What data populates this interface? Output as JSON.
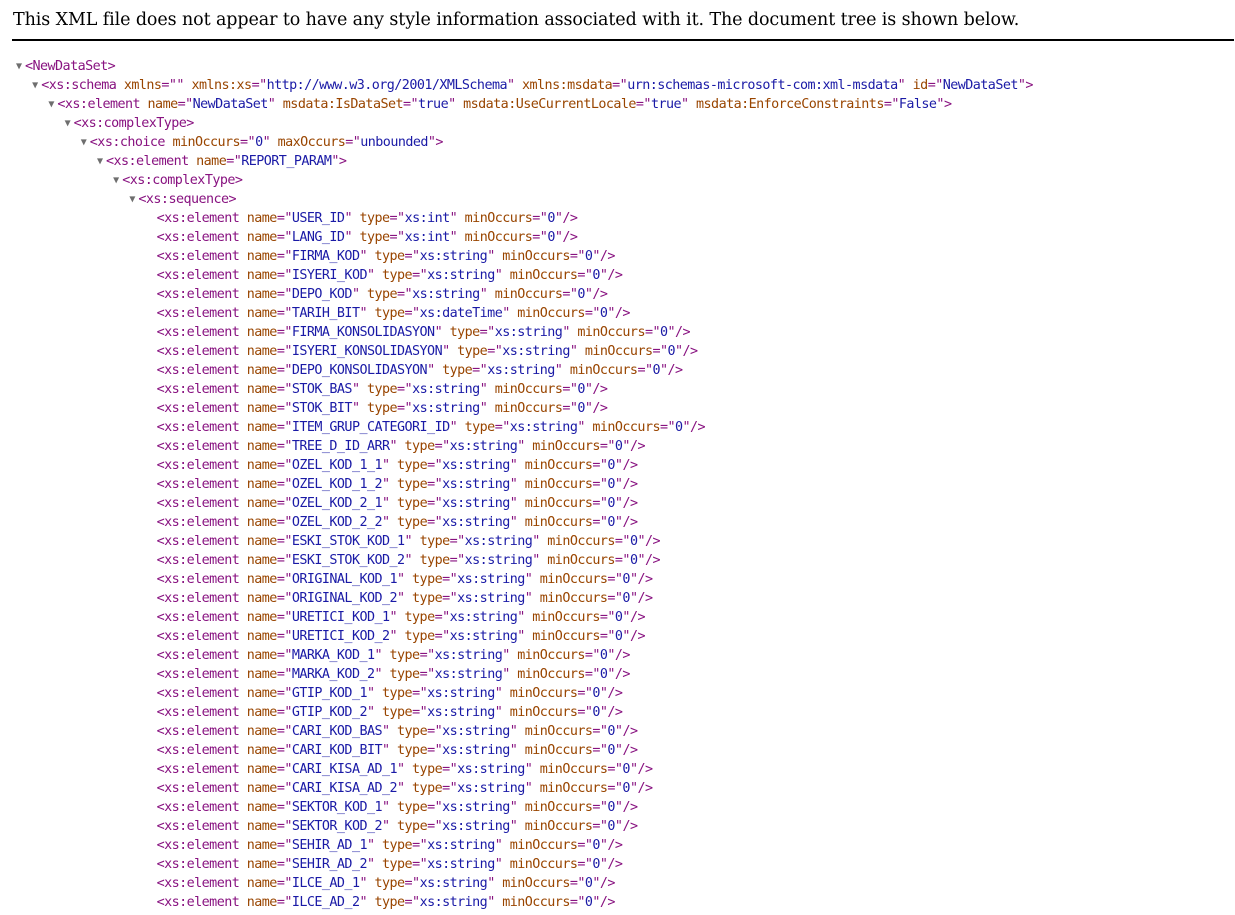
{
  "info_message": "This XML file does not appear to have any style information associated with it. The document tree is shown below.",
  "toggle_glyph": "▼",
  "tree": [
    {
      "depth": 0,
      "toggle": true,
      "tag": "NewDataSet",
      "attrs": [],
      "selfclose": false
    },
    {
      "depth": 1,
      "toggle": true,
      "tag": "xs:schema",
      "attrs": [
        {
          "n": "xmlns",
          "v": ""
        },
        {
          "n": "xmlns:xs",
          "v": "http://www.w3.org/2001/XMLSchema"
        },
        {
          "n": "xmlns:msdata",
          "v": "urn:schemas-microsoft-com:xml-msdata"
        },
        {
          "n": "id",
          "v": "NewDataSet"
        }
      ],
      "selfclose": false
    },
    {
      "depth": 2,
      "toggle": true,
      "tag": "xs:element",
      "attrs": [
        {
          "n": "name",
          "v": "NewDataSet"
        },
        {
          "n": "msdata:IsDataSet",
          "v": "true"
        },
        {
          "n": "msdata:UseCurrentLocale",
          "v": "true"
        },
        {
          "n": "msdata:EnforceConstraints",
          "v": "False"
        }
      ],
      "selfclose": false
    },
    {
      "depth": 3,
      "toggle": true,
      "tag": "xs:complexType",
      "attrs": [],
      "selfclose": false
    },
    {
      "depth": 4,
      "toggle": true,
      "tag": "xs:choice",
      "attrs": [
        {
          "n": "minOccurs",
          "v": "0"
        },
        {
          "n": "maxOccurs",
          "v": "unbounded"
        }
      ],
      "selfclose": false
    },
    {
      "depth": 5,
      "toggle": true,
      "tag": "xs:element",
      "attrs": [
        {
          "n": "name",
          "v": "REPORT_PARAM"
        }
      ],
      "selfclose": false
    },
    {
      "depth": 6,
      "toggle": true,
      "tag": "xs:complexType",
      "attrs": [],
      "selfclose": false
    },
    {
      "depth": 7,
      "toggle": true,
      "tag": "xs:sequence",
      "attrs": [],
      "selfclose": false
    },
    {
      "depth": 8,
      "toggle": false,
      "tag": "xs:element",
      "attrs": [
        {
          "n": "name",
          "v": "USER_ID"
        },
        {
          "n": "type",
          "v": "xs:int"
        },
        {
          "n": "minOccurs",
          "v": "0"
        }
      ],
      "selfclose": true
    },
    {
      "depth": 8,
      "toggle": false,
      "tag": "xs:element",
      "attrs": [
        {
          "n": "name",
          "v": "LANG_ID"
        },
        {
          "n": "type",
          "v": "xs:int"
        },
        {
          "n": "minOccurs",
          "v": "0"
        }
      ],
      "selfclose": true
    },
    {
      "depth": 8,
      "toggle": false,
      "tag": "xs:element",
      "attrs": [
        {
          "n": "name",
          "v": "FIRMA_KOD"
        },
        {
          "n": "type",
          "v": "xs:string"
        },
        {
          "n": "minOccurs",
          "v": "0"
        }
      ],
      "selfclose": true
    },
    {
      "depth": 8,
      "toggle": false,
      "tag": "xs:element",
      "attrs": [
        {
          "n": "name",
          "v": "ISYERI_KOD"
        },
        {
          "n": "type",
          "v": "xs:string"
        },
        {
          "n": "minOccurs",
          "v": "0"
        }
      ],
      "selfclose": true
    },
    {
      "depth": 8,
      "toggle": false,
      "tag": "xs:element",
      "attrs": [
        {
          "n": "name",
          "v": "DEPO_KOD"
        },
        {
          "n": "type",
          "v": "xs:string"
        },
        {
          "n": "minOccurs",
          "v": "0"
        }
      ],
      "selfclose": true
    },
    {
      "depth": 8,
      "toggle": false,
      "tag": "xs:element",
      "attrs": [
        {
          "n": "name",
          "v": "TARIH_BIT"
        },
        {
          "n": "type",
          "v": "xs:dateTime"
        },
        {
          "n": "minOccurs",
          "v": "0"
        }
      ],
      "selfclose": true
    },
    {
      "depth": 8,
      "toggle": false,
      "tag": "xs:element",
      "attrs": [
        {
          "n": "name",
          "v": "FIRMA_KONSOLIDASYON"
        },
        {
          "n": "type",
          "v": "xs:string"
        },
        {
          "n": "minOccurs",
          "v": "0"
        }
      ],
      "selfclose": true
    },
    {
      "depth": 8,
      "toggle": false,
      "tag": "xs:element",
      "attrs": [
        {
          "n": "name",
          "v": "ISYERI_KONSOLIDASYON"
        },
        {
          "n": "type",
          "v": "xs:string"
        },
        {
          "n": "minOccurs",
          "v": "0"
        }
      ],
      "selfclose": true
    },
    {
      "depth": 8,
      "toggle": false,
      "tag": "xs:element",
      "attrs": [
        {
          "n": "name",
          "v": "DEPO_KONSOLIDASYON"
        },
        {
          "n": "type",
          "v": "xs:string"
        },
        {
          "n": "minOccurs",
          "v": "0"
        }
      ],
      "selfclose": true
    },
    {
      "depth": 8,
      "toggle": false,
      "tag": "xs:element",
      "attrs": [
        {
          "n": "name",
          "v": "STOK_BAS"
        },
        {
          "n": "type",
          "v": "xs:string"
        },
        {
          "n": "minOccurs",
          "v": "0"
        }
      ],
      "selfclose": true
    },
    {
      "depth": 8,
      "toggle": false,
      "tag": "xs:element",
      "attrs": [
        {
          "n": "name",
          "v": "STOK_BIT"
        },
        {
          "n": "type",
          "v": "xs:string"
        },
        {
          "n": "minOccurs",
          "v": "0"
        }
      ],
      "selfclose": true
    },
    {
      "depth": 8,
      "toggle": false,
      "tag": "xs:element",
      "attrs": [
        {
          "n": "name",
          "v": "ITEM_GRUP_CATEGORI_ID"
        },
        {
          "n": "type",
          "v": "xs:string"
        },
        {
          "n": "minOccurs",
          "v": "0"
        }
      ],
      "selfclose": true
    },
    {
      "depth": 8,
      "toggle": false,
      "tag": "xs:element",
      "attrs": [
        {
          "n": "name",
          "v": "TREE_D_ID_ARR"
        },
        {
          "n": "type",
          "v": "xs:string"
        },
        {
          "n": "minOccurs",
          "v": "0"
        }
      ],
      "selfclose": true
    },
    {
      "depth": 8,
      "toggle": false,
      "tag": "xs:element",
      "attrs": [
        {
          "n": "name",
          "v": "OZEL_KOD_1_1"
        },
        {
          "n": "type",
          "v": "xs:string"
        },
        {
          "n": "minOccurs",
          "v": "0"
        }
      ],
      "selfclose": true
    },
    {
      "depth": 8,
      "toggle": false,
      "tag": "xs:element",
      "attrs": [
        {
          "n": "name",
          "v": "OZEL_KOD_1_2"
        },
        {
          "n": "type",
          "v": "xs:string"
        },
        {
          "n": "minOccurs",
          "v": "0"
        }
      ],
      "selfclose": true
    },
    {
      "depth": 8,
      "toggle": false,
      "tag": "xs:element",
      "attrs": [
        {
          "n": "name",
          "v": "OZEL_KOD_2_1"
        },
        {
          "n": "type",
          "v": "xs:string"
        },
        {
          "n": "minOccurs",
          "v": "0"
        }
      ],
      "selfclose": true
    },
    {
      "depth": 8,
      "toggle": false,
      "tag": "xs:element",
      "attrs": [
        {
          "n": "name",
          "v": "OZEL_KOD_2_2"
        },
        {
          "n": "type",
          "v": "xs:string"
        },
        {
          "n": "minOccurs",
          "v": "0"
        }
      ],
      "selfclose": true
    },
    {
      "depth": 8,
      "toggle": false,
      "tag": "xs:element",
      "attrs": [
        {
          "n": "name",
          "v": "ESKI_STOK_KOD_1"
        },
        {
          "n": "type",
          "v": "xs:string"
        },
        {
          "n": "minOccurs",
          "v": "0"
        }
      ],
      "selfclose": true
    },
    {
      "depth": 8,
      "toggle": false,
      "tag": "xs:element",
      "attrs": [
        {
          "n": "name",
          "v": "ESKI_STOK_KOD_2"
        },
        {
          "n": "type",
          "v": "xs:string"
        },
        {
          "n": "minOccurs",
          "v": "0"
        }
      ],
      "selfclose": true
    },
    {
      "depth": 8,
      "toggle": false,
      "tag": "xs:element",
      "attrs": [
        {
          "n": "name",
          "v": "ORIGINAL_KOD_1"
        },
        {
          "n": "type",
          "v": "xs:string"
        },
        {
          "n": "minOccurs",
          "v": "0"
        }
      ],
      "selfclose": true
    },
    {
      "depth": 8,
      "toggle": false,
      "tag": "xs:element",
      "attrs": [
        {
          "n": "name",
          "v": "ORIGINAL_KOD_2"
        },
        {
          "n": "type",
          "v": "xs:string"
        },
        {
          "n": "minOccurs",
          "v": "0"
        }
      ],
      "selfclose": true
    },
    {
      "depth": 8,
      "toggle": false,
      "tag": "xs:element",
      "attrs": [
        {
          "n": "name",
          "v": "URETICI_KOD_1"
        },
        {
          "n": "type",
          "v": "xs:string"
        },
        {
          "n": "minOccurs",
          "v": "0"
        }
      ],
      "selfclose": true
    },
    {
      "depth": 8,
      "toggle": false,
      "tag": "xs:element",
      "attrs": [
        {
          "n": "name",
          "v": "URETICI_KOD_2"
        },
        {
          "n": "type",
          "v": "xs:string"
        },
        {
          "n": "minOccurs",
          "v": "0"
        }
      ],
      "selfclose": true
    },
    {
      "depth": 8,
      "toggle": false,
      "tag": "xs:element",
      "attrs": [
        {
          "n": "name",
          "v": "MARKA_KOD_1"
        },
        {
          "n": "type",
          "v": "xs:string"
        },
        {
          "n": "minOccurs",
          "v": "0"
        }
      ],
      "selfclose": true
    },
    {
      "depth": 8,
      "toggle": false,
      "tag": "xs:element",
      "attrs": [
        {
          "n": "name",
          "v": "MARKA_KOD_2"
        },
        {
          "n": "type",
          "v": "xs:string"
        },
        {
          "n": "minOccurs",
          "v": "0"
        }
      ],
      "selfclose": true
    },
    {
      "depth": 8,
      "toggle": false,
      "tag": "xs:element",
      "attrs": [
        {
          "n": "name",
          "v": "GTIP_KOD_1"
        },
        {
          "n": "type",
          "v": "xs:string"
        },
        {
          "n": "minOccurs",
          "v": "0"
        }
      ],
      "selfclose": true
    },
    {
      "depth": 8,
      "toggle": false,
      "tag": "xs:element",
      "attrs": [
        {
          "n": "name",
          "v": "GTIP_KOD_2"
        },
        {
          "n": "type",
          "v": "xs:string"
        },
        {
          "n": "minOccurs",
          "v": "0"
        }
      ],
      "selfclose": true
    },
    {
      "depth": 8,
      "toggle": false,
      "tag": "xs:element",
      "attrs": [
        {
          "n": "name",
          "v": "CARI_KOD_BAS"
        },
        {
          "n": "type",
          "v": "xs:string"
        },
        {
          "n": "minOccurs",
          "v": "0"
        }
      ],
      "selfclose": true
    },
    {
      "depth": 8,
      "toggle": false,
      "tag": "xs:element",
      "attrs": [
        {
          "n": "name",
          "v": "CARI_KOD_BIT"
        },
        {
          "n": "type",
          "v": "xs:string"
        },
        {
          "n": "minOccurs",
          "v": "0"
        }
      ],
      "selfclose": true
    },
    {
      "depth": 8,
      "toggle": false,
      "tag": "xs:element",
      "attrs": [
        {
          "n": "name",
          "v": "CARI_KISA_AD_1"
        },
        {
          "n": "type",
          "v": "xs:string"
        },
        {
          "n": "minOccurs",
          "v": "0"
        }
      ],
      "selfclose": true
    },
    {
      "depth": 8,
      "toggle": false,
      "tag": "xs:element",
      "attrs": [
        {
          "n": "name",
          "v": "CARI_KISA_AD_2"
        },
        {
          "n": "type",
          "v": "xs:string"
        },
        {
          "n": "minOccurs",
          "v": "0"
        }
      ],
      "selfclose": true
    },
    {
      "depth": 8,
      "toggle": false,
      "tag": "xs:element",
      "attrs": [
        {
          "n": "name",
          "v": "SEKTOR_KOD_1"
        },
        {
          "n": "type",
          "v": "xs:string"
        },
        {
          "n": "minOccurs",
          "v": "0"
        }
      ],
      "selfclose": true
    },
    {
      "depth": 8,
      "toggle": false,
      "tag": "xs:element",
      "attrs": [
        {
          "n": "name",
          "v": "SEKTOR_KOD_2"
        },
        {
          "n": "type",
          "v": "xs:string"
        },
        {
          "n": "minOccurs",
          "v": "0"
        }
      ],
      "selfclose": true
    },
    {
      "depth": 8,
      "toggle": false,
      "tag": "xs:element",
      "attrs": [
        {
          "n": "name",
          "v": "SEHIR_AD_1"
        },
        {
          "n": "type",
          "v": "xs:string"
        },
        {
          "n": "minOccurs",
          "v": "0"
        }
      ],
      "selfclose": true
    },
    {
      "depth": 8,
      "toggle": false,
      "tag": "xs:element",
      "attrs": [
        {
          "n": "name",
          "v": "SEHIR_AD_2"
        },
        {
          "n": "type",
          "v": "xs:string"
        },
        {
          "n": "minOccurs",
          "v": "0"
        }
      ],
      "selfclose": true
    },
    {
      "depth": 8,
      "toggle": false,
      "tag": "xs:element",
      "attrs": [
        {
          "n": "name",
          "v": "ILCE_AD_1"
        },
        {
          "n": "type",
          "v": "xs:string"
        },
        {
          "n": "minOccurs",
          "v": "0"
        }
      ],
      "selfclose": true
    },
    {
      "depth": 8,
      "toggle": false,
      "tag": "xs:element",
      "attrs": [
        {
          "n": "name",
          "v": "ILCE_AD_2"
        },
        {
          "n": "type",
          "v": "xs:string"
        },
        {
          "n": "minOccurs",
          "v": "0"
        }
      ],
      "selfclose": true
    }
  ]
}
